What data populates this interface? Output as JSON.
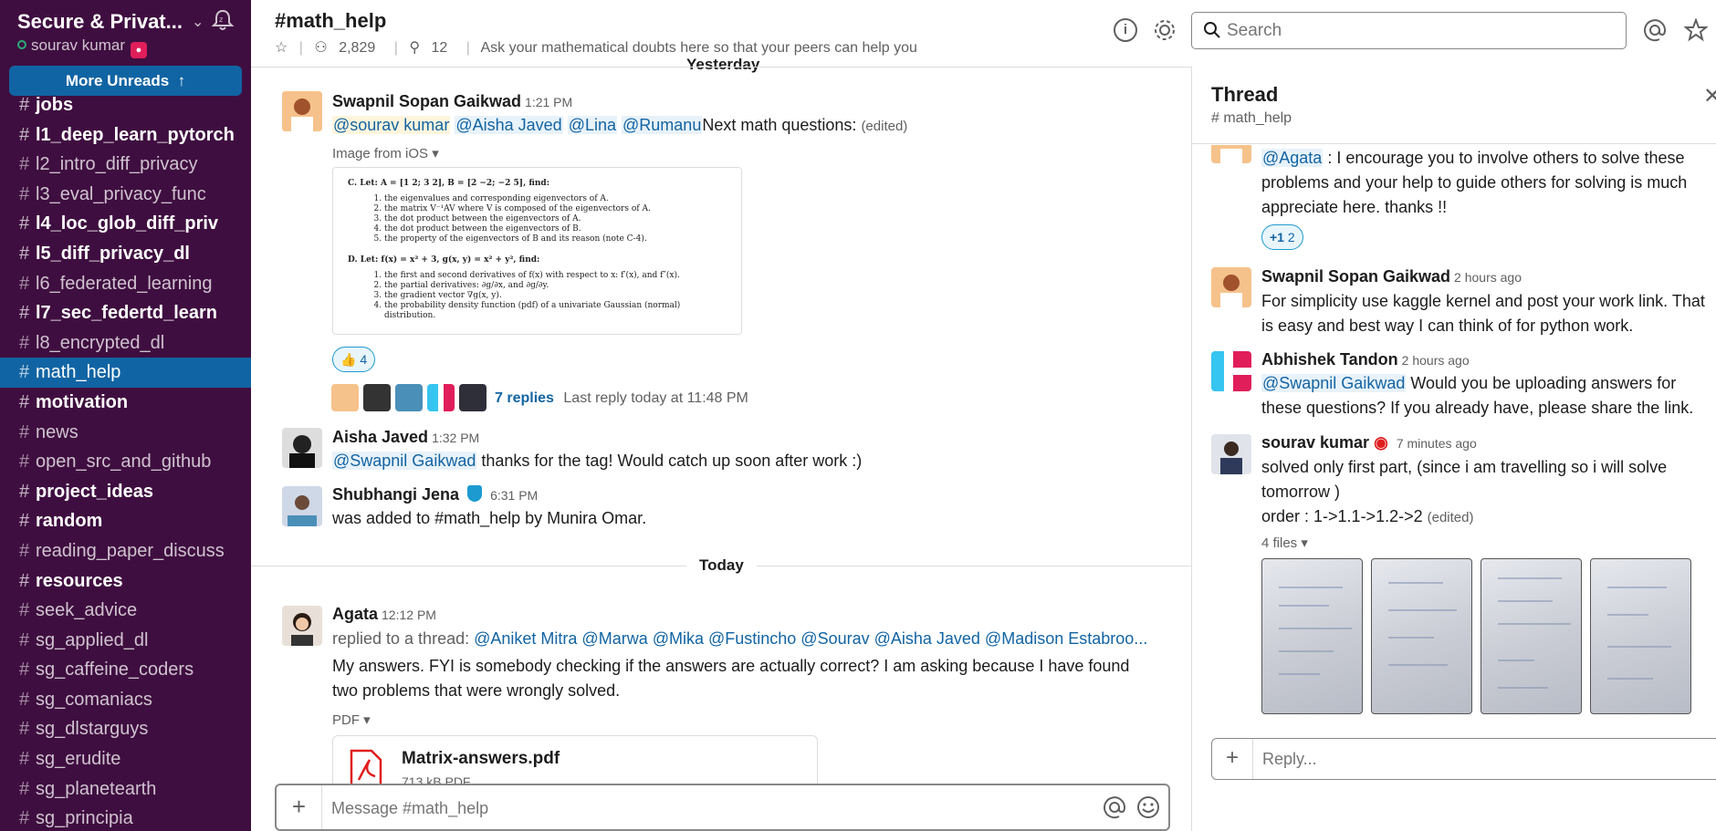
{
  "workspace": {
    "name": "Secure & Privat...",
    "user": "sourav kumar",
    "more_unreads": "More Unreads"
  },
  "channels": [
    {
      "name": "jobs",
      "unread": true
    },
    {
      "name": "l1_deep_learn_pytorch",
      "unread": true
    },
    {
      "name": "l2_intro_diff_privacy",
      "unread": false
    },
    {
      "name": "l3_eval_privacy_func",
      "unread": false
    },
    {
      "name": "l4_loc_glob_diff_priv",
      "unread": true
    },
    {
      "name": "l5_diff_privacy_dl",
      "unread": true
    },
    {
      "name": "l6_federated_learning",
      "unread": false
    },
    {
      "name": "l7_sec_federtd_learn",
      "unread": true
    },
    {
      "name": "l8_encrypted_dl",
      "unread": false
    },
    {
      "name": "math_help",
      "unread": false,
      "active": true
    },
    {
      "name": "motivation",
      "unread": true
    },
    {
      "name": "news",
      "unread": false
    },
    {
      "name": "open_src_and_github",
      "unread": false
    },
    {
      "name": "project_ideas",
      "unread": true
    },
    {
      "name": "random",
      "unread": true
    },
    {
      "name": "reading_paper_discuss",
      "unread": false
    },
    {
      "name": "resources",
      "unread": true
    },
    {
      "name": "seek_advice",
      "unread": false
    },
    {
      "name": "sg_applied_dl",
      "unread": false
    },
    {
      "name": "sg_caffeine_coders",
      "unread": false
    },
    {
      "name": "sg_comaniacs",
      "unread": false
    },
    {
      "name": "sg_dlstarguys",
      "unread": false
    },
    {
      "name": "sg_erudite",
      "unread": false
    },
    {
      "name": "sg_planetearth",
      "unread": false
    },
    {
      "name": "sg_principia",
      "unread": false
    }
  ],
  "header": {
    "title": "#math_help",
    "members": "2,829",
    "pins": "12",
    "topic": "Ask your mathematical doubts here so that your peers can help you",
    "search_placeholder": "Search"
  },
  "dividers": {
    "yesterday": "Yesterday",
    "today": "Today"
  },
  "messages": {
    "m1": {
      "author": "Swapnil Sopan Gaikwad",
      "time": "1:21 PM",
      "mentions": [
        "@sourav kumar",
        "@Aisha Javed",
        "@Lina",
        "@Rumanu"
      ],
      "text": "Next math questions:",
      "edited": "(edited)",
      "attachment_label": "Image from iOS",
      "reaction_count": "4",
      "replies": "7 replies",
      "last_reply": "Last reply today at 11:48 PM",
      "image": {
        "c_head": "C. Let: A = [1 2; 3 2], B = [2 −2; −2 5], find:",
        "c_items": [
          "the eigenvalues and corresponding eigenvectors of A.",
          "the matrix V⁻¹AV where V is composed of the eigenvectors of A.",
          "the dot product between the eigenvectors of A.",
          "the dot product between the eigenvectors of B.",
          "the property of the eigenvectors of B and its reason (note C-4)."
        ],
        "d_head": "D. Let: f(x) = x² + 3,   g(x, y) = x² + y², find:",
        "d_items": [
          "the first and second derivatives of f(x) with respect to x: f′(x), and f″(x).",
          "the partial derivatives: ∂g/∂x, and ∂g/∂y.",
          "the gradient vector ∇g(x, y).",
          "the probability density function (pdf) of a univariate Gaussian (normal) distribution."
        ]
      }
    },
    "m2": {
      "author": "Aisha Javed",
      "time": "1:32 PM",
      "mention": "@Swapnil Gaikwad",
      "text": "thanks for the tag! Would catch up soon after work :)"
    },
    "m3": {
      "author": "Shubhangi Jena",
      "time": "6:31 PM",
      "text": "was added to #math_help by Munira Omar."
    },
    "m4": {
      "author": "Agata",
      "time": "12:12 PM",
      "reply_prefix": "replied to a thread:",
      "mentions": "@Aniket Mitra @Marwa @Mika @Fustincho @Sourav @Aisha Javed @Madison Estabroo...",
      "line1": "My answers. FYI is somebody checking if the answers are actually correct? I am asking because I have found",
      "line2": "two problems that were wrongly solved.",
      "attachment_label": "PDF",
      "file_name": "Matrix-answers.pdf",
      "file_size": "713 kB PDF"
    }
  },
  "composer": {
    "placeholder": "Message #math_help"
  },
  "thread": {
    "title": "Thread",
    "channel": "math_help",
    "t1": {
      "mention": "@Agata",
      "line1": ": I encourage you to involve others to solve these",
      "line2": "problems and your help to guide others for solving is much",
      "line3": "appreciate here. thanks !!",
      "reaction": "+1",
      "reaction_count": "2"
    },
    "t2": {
      "author": "Swapnil Sopan Gaikwad",
      "time": "2 hours ago",
      "line1": "For simplicity use kaggle kernel and post your work link. That",
      "line2": "is easy and best way I can think of for python work."
    },
    "t3": {
      "author": "Abhishek Tandon",
      "time": "2 hours ago",
      "mention": "@Swapnil Gaikwad",
      "line1": "Would you be uploading answers for",
      "line2": "these questions? If you already have, please share the link."
    },
    "t4": {
      "author": "sourav kumar",
      "time": "7 minutes ago",
      "line1": "solved only first part, (since i am travelling so i will solve",
      "line2": "tomorrow )",
      "line3": "order : 1->1.1->1.2->2",
      "edited": "(edited)",
      "files_label": "4 files"
    },
    "reply_placeholder": "Reply..."
  }
}
